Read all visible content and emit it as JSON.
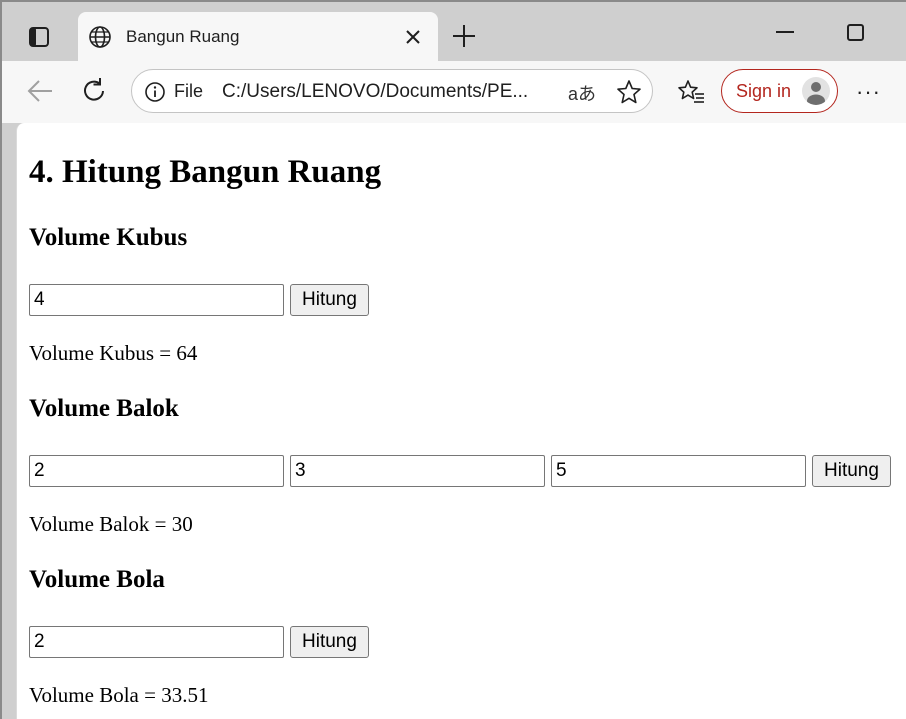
{
  "browser": {
    "tab_title": "Bangun Ruang",
    "address_scheme": "File",
    "address_url": "C:/Users/LENOVO/Documents/PE...",
    "read_aloud_glyph": "aあ",
    "sign_in_label": "Sign in",
    "more_glyph": "···",
    "accent_color": "#b3261e"
  },
  "page": {
    "heading": "4. Hitung Bangun Ruang",
    "kubus": {
      "title": "Volume Kubus",
      "side_value": "4",
      "button_label": "Hitung",
      "result": "Volume Kubus = 64"
    },
    "balok": {
      "title": "Volume Balok",
      "length_value": "2",
      "width_value": "3",
      "height_value": "5",
      "button_label": "Hitung",
      "result": "Volume Balok = 30"
    },
    "bola": {
      "title": "Volume Bola",
      "radius_value": "2",
      "button_label": "Hitung",
      "result": "Volume Bola = 33.51"
    }
  }
}
